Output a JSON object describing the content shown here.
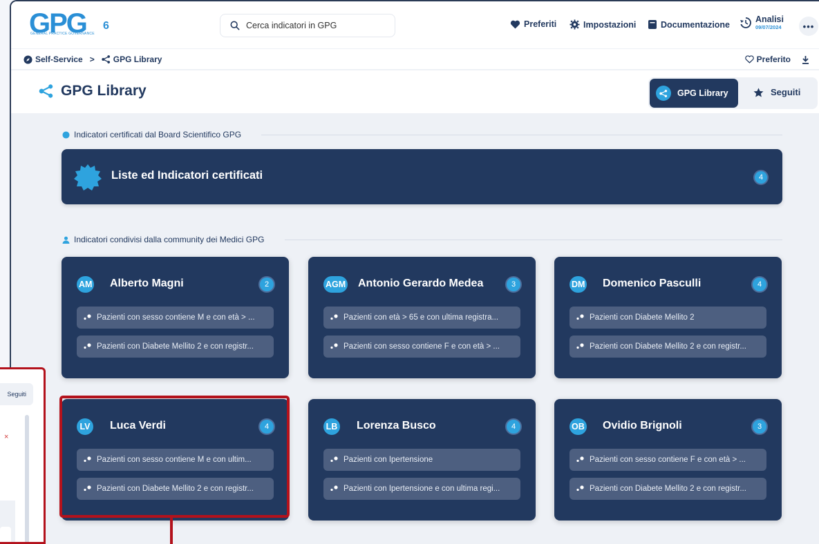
{
  "app": {
    "logo_text": "GPG",
    "logo_sub": "GENERAL PRACTICE GOVERNANCE",
    "logo_num": "6",
    "accent_color": "#2ea3de",
    "navy_color": "#22395f",
    "highlight_color": "#b3121c"
  },
  "topbar": {
    "search_placeholder": "Cerca indicatori in GPG",
    "nav": {
      "preferiti": "Preferiti",
      "impostazioni": "Impostazioni",
      "documentazione": "Documentazione",
      "analisi": "Analisi",
      "analisi_date": "09/07/2024"
    },
    "more": "•••"
  },
  "breadcrumb": {
    "items": [
      "Self-Service",
      "GPG Library"
    ],
    "separator": ">",
    "preferito": "Preferito"
  },
  "page": {
    "title": "GPG Library",
    "tabs": {
      "library": "GPG Library",
      "seguiti": "Seguiti"
    }
  },
  "sections": {
    "certified_label": "Indicatori certificati dal Board Scientifico GPG",
    "certified_card": {
      "title": "Liste ed Indicatori certificati",
      "count": "4"
    },
    "community_label": "Indicatori condivisi dalla community dei Medici GPG"
  },
  "users": [
    {
      "initials": "AM",
      "name": "Alberto Magni",
      "count": "2",
      "items": [
        "Pazienti con sesso contiene M e con età > ...",
        "Pazienti con Diabete Mellito 2 e con registr..."
      ]
    },
    {
      "initials": "AGM",
      "name": "Antonio Gerardo Medea",
      "count": "3",
      "items": [
        "Pazienti con età > 65 e con ultima registra...",
        "Pazienti con sesso contiene F e con età > ..."
      ]
    },
    {
      "initials": "DM",
      "name": "Domenico Pasculli",
      "count": "4",
      "items": [
        "Pazienti con Diabete Mellito 2",
        "Pazienti con Diabete Mellito 2 e con registr..."
      ]
    },
    {
      "initials": "LV",
      "name": "Luca Verdi",
      "count": "4",
      "items": [
        "Pazienti con sesso contiene M e con ultim...",
        "Pazienti con Diabete Mellito 2 e con registr..."
      ]
    },
    {
      "initials": "LB",
      "name": "Lorenza Busco",
      "count": "4",
      "items": [
        "Pazienti con Ipertensione",
        "Pazienti con Ipertensione e con ultima regi..."
      ]
    },
    {
      "initials": "OB",
      "name": "Ovidio Brignoli",
      "count": "3",
      "items": [
        "Pazienti con sesso contiene F e con età > ...",
        "Pazienti con Diabete Mellito 2 e con registr..."
      ]
    }
  ],
  "popup": {
    "seguiti": "Seguiti",
    "close": "×"
  }
}
